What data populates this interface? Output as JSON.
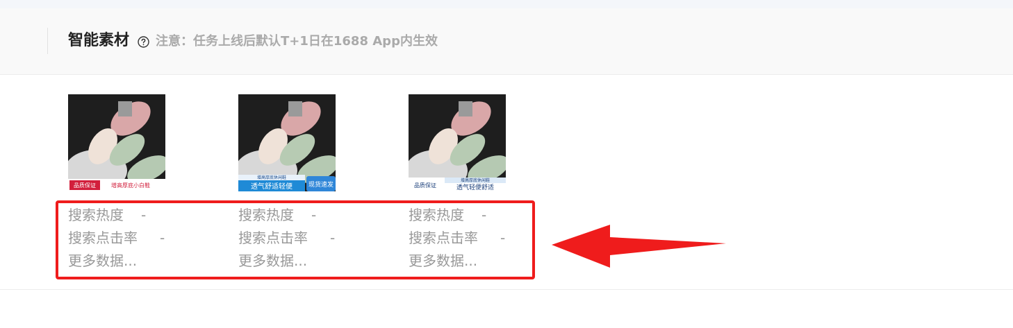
{
  "header": {
    "title": "智能素材",
    "note": "注意：任务上线后默认T+1日在1688 App内生效"
  },
  "cards": [
    {
      "badge": "品质保证",
      "tagline": "增高厚底小白鞋",
      "stats": [
        {
          "label": "搜索热度",
          "value": "-"
        },
        {
          "label": "搜索点击率",
          "value": "-"
        },
        {
          "label": "更多数据...",
          "value": ""
        }
      ]
    },
    {
      "badge": "现货速发",
      "banner_top": "增高厚底休闲鞋",
      "tagline": "透气舒适轻便",
      "stats": [
        {
          "label": "搜索热度",
          "value": "-"
        },
        {
          "label": "搜索点击率",
          "value": "-"
        },
        {
          "label": "更多数据...",
          "value": ""
        }
      ]
    },
    {
      "badge": "品质保证",
      "banner_top": "增高厚底休闲鞋",
      "tagline": "透气轻便舒适",
      "stats": [
        {
          "label": "搜索热度",
          "value": "-"
        },
        {
          "label": "搜索点击率",
          "value": "-"
        },
        {
          "label": "更多数据...",
          "value": ""
        }
      ]
    }
  ],
  "annotation": {
    "color": "#ef1c1c",
    "icon": "left-arrow-icon"
  }
}
